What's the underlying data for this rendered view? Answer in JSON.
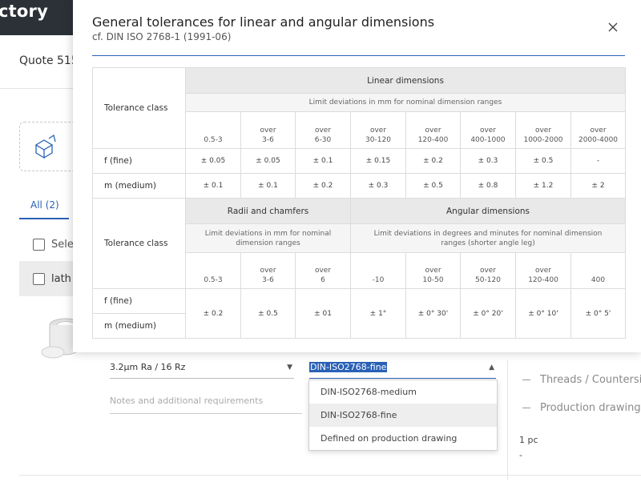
{
  "background": {
    "brand_text": "ctory",
    "quote_title": "Quote 515",
    "tab_all": "All (2)",
    "row_select_label": "Sele",
    "row_part_label": "lath",
    "roughness_value": "3.2µm Ra / 16 Rz",
    "notes_placeholder": "Notes and additional requirements",
    "tolerance_value": "DIN-ISO2768-fine",
    "tolerance_options": [
      "DIN-ISO2768-medium",
      "DIN-ISO2768-fine",
      "Defined on production drawing"
    ],
    "side_items": [
      "Threads / Countersinks",
      "Production drawing"
    ],
    "quantity": "1 pc",
    "price": "-"
  },
  "modal": {
    "title": "General tolerances for linear and angular dimensions",
    "subtitle": "cf. DIN ISO 2768-1 (1991-06)",
    "linear": {
      "class_header": "Tolerance class",
      "group_header": "Linear dimensions",
      "subheader": "Limit deviations in mm for nominal dimension ranges",
      "ranges": [
        [
          "",
          "0.5-3"
        ],
        [
          "over",
          "3-6"
        ],
        [
          "over",
          "6-30"
        ],
        [
          "over",
          "30-120"
        ],
        [
          "over",
          "120-400"
        ],
        [
          "over",
          "400-1000"
        ],
        [
          "over",
          "1000-2000"
        ],
        [
          "over",
          "2000-4000"
        ]
      ],
      "rows": [
        {
          "label": "f (fine)",
          "values": [
            "± 0.05",
            "± 0.05",
            "± 0.1",
            "± 0.15",
            "± 0.2",
            "± 0.3",
            "± 0.5",
            "-"
          ]
        },
        {
          "label": "m (medium)",
          "values": [
            "± 0.1",
            "± 0.1",
            "± 0.2",
            "± 0.3",
            "± 0.5",
            "± 0.8",
            "± 1.2",
            "± 2"
          ]
        }
      ]
    },
    "radii": {
      "class_header": "Tolerance class",
      "group_header": "Radii and chamfers",
      "subheader": "Limit deviations in mm for nominal dimension ranges",
      "ranges": [
        [
          "",
          "0.5-3"
        ],
        [
          "over",
          "3-6"
        ],
        [
          "over",
          "6"
        ]
      ],
      "values": [
        "± 0.2",
        "± 0.5",
        "± 01"
      ]
    },
    "angular": {
      "group_header": "Angular dimensions",
      "subheader": "Limit deviations in degrees and minutes for nominal dimension ranges (shorter angle leg)",
      "ranges": [
        [
          "",
          "-10"
        ],
        [
          "over",
          "10-50"
        ],
        [
          "over",
          "50-120"
        ],
        [
          "over",
          "120-400"
        ],
        [
          "",
          "400"
        ]
      ],
      "values": [
        "± 1°",
        "± 0° 30'",
        "± 0° 20'",
        "± 0° 10'",
        "± 0° 5'"
      ]
    },
    "row_labels": [
      "f (fine)",
      "m (medium)"
    ]
  }
}
